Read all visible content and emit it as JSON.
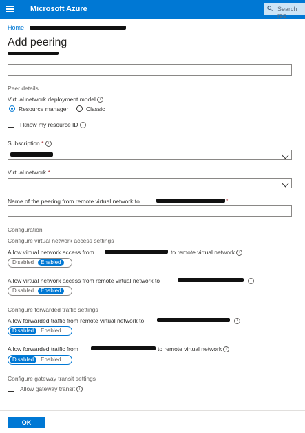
{
  "header": {
    "brand": "Microsoft Azure",
    "search_placeholder": "Search res"
  },
  "breadcrumb": {
    "home": "Home"
  },
  "page": {
    "title": "Add peering"
  },
  "peer_details": {
    "section": "Peer details",
    "deployment_model_label": "Virtual network deployment model",
    "options": [
      "Resource manager",
      "Classic"
    ],
    "selected": "Resource manager",
    "know_resource_id_label": "I know my resource ID"
  },
  "subscription": {
    "label": "Subscription",
    "required": "*",
    "value": ""
  },
  "virtual_network": {
    "label": "Virtual network",
    "required": "*",
    "value": ""
  },
  "remote_peering_name": {
    "label": "Name of the peering from remote virtual network to",
    "required": "*",
    "value": ""
  },
  "configuration": {
    "section": "Configuration",
    "access_section": "Configure virtual network access settings",
    "allow_access_local_prefix": "Allow virtual network access from",
    "allow_access_local_suffix": "to remote virtual network",
    "allow_access_remote_label": "Allow virtual network access from remote virtual network to",
    "forwarded_section": "Configure forwarded traffic settings",
    "allow_fwd_remote_label": "Allow forwarded traffic from remote virtual network to",
    "allow_fwd_local_prefix": "Allow forwarded traffic from",
    "allow_fwd_local_suffix": "to remote virtual network",
    "gateway_section": "Configure gateway transit settings",
    "gateway_label": "Allow gateway transit"
  },
  "toggle": {
    "disabled": "Disabled",
    "enabled": "Enabled"
  },
  "toggle_state": {
    "access_local": "Enabled",
    "access_remote": "Enabled",
    "fwd_remote": "Disabled",
    "fwd_local": "Disabled"
  },
  "footer": {
    "ok": "OK"
  },
  "colors": {
    "accent": "#0078d4",
    "required": "#a4262c"
  }
}
